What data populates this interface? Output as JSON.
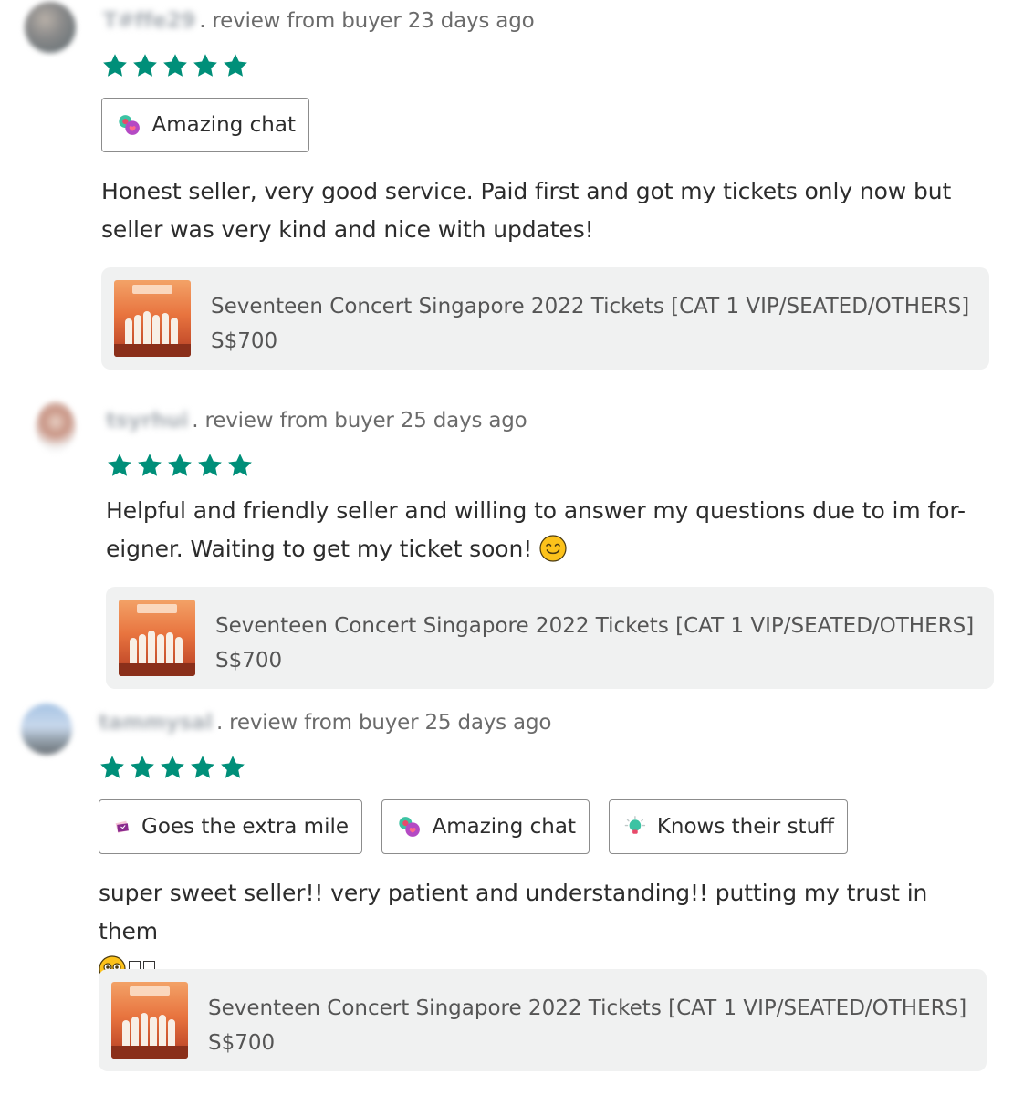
{
  "reviews": [
    {
      "username": "T#ffe29",
      "meta": ". review from buyer 23 days ago",
      "rating": 5,
      "tags": [
        {
          "label": "Amazing chat",
          "icon": "chat-heart-icon"
        }
      ],
      "text": "Honest seller, very good service. Paid first and got my tickets only now but seller was very kind and nice with updates!",
      "product": {
        "title": "Seventeen Concert Singapore 2022 Tickets [CAT 1 VIP/SEATED/OTHERS]",
        "price": "S$700"
      }
    },
    {
      "username": "tsyrhui",
      "meta": ". review from buyer 25 days ago",
      "rating": 5,
      "tags": [],
      "text": "Helpful and friendly seller and willing to answer my questions due to im for-eigner. Waiting to get my ticket soon!",
      "product": {
        "title": "Seventeen Concert Singapore 2022 Tickets [CAT 1 VIP/SEATED/OTHERS]",
        "price": "S$700"
      }
    },
    {
      "username": "tammysal",
      "meta": ". review from buyer 25 days ago",
      "rating": 5,
      "tags": [
        {
          "label": "Goes the extra mile",
          "icon": "ticket-icon"
        },
        {
          "label": "Amazing chat",
          "icon": "chat-heart-icon"
        },
        {
          "label": "Knows their stuff",
          "icon": "lightbulb-icon"
        }
      ],
      "text": "super sweet seller!! very patient and understanding!! putting my trust in them",
      "product": {
        "title": "Seventeen Concert Singapore 2022 Tickets [CAT 1 VIP/SEATED/OTHERS]",
        "price": "S$700"
      }
    }
  ],
  "colors": {
    "star": "#008f79",
    "chip_border": "#8c8c8c",
    "product_bg": "#f0f1f1",
    "meta_text": "#6b6b6b"
  }
}
